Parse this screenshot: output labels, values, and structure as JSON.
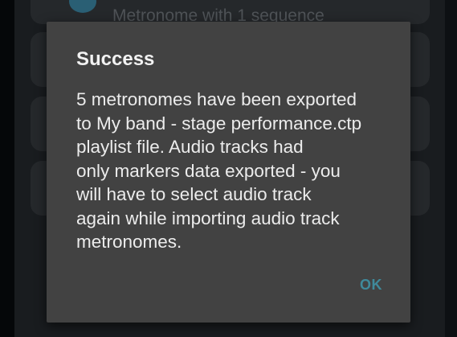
{
  "background": {
    "list_item_subtitle": "Metronome with 1 sequence"
  },
  "dialog": {
    "title": "Success",
    "message": "5 metronomes have been exported\nto My band - stage performance.ctp\nplaylist file. Audio tracks had\nonly markers data exported - you\nwill have to select audio track\nagain while importing audio track\nmetronomes.",
    "ok_label": "OK"
  },
  "colors": {
    "dialog_background": "#424242",
    "accent": "#3f8a9b",
    "scrim": "#050709"
  }
}
